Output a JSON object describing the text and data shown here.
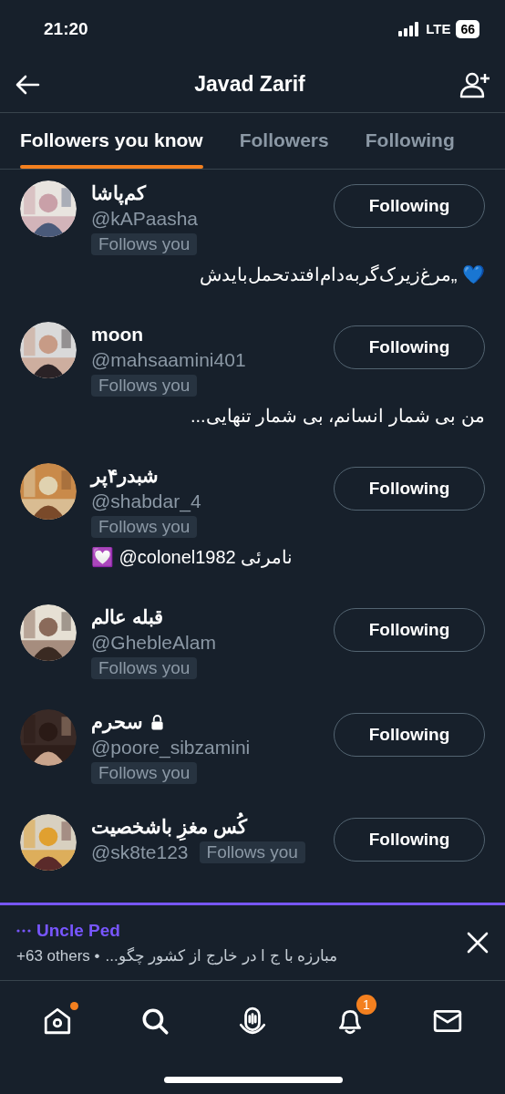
{
  "status_bar": {
    "time": "21:20",
    "network": "LTE",
    "battery": "66"
  },
  "header": {
    "title": "Javad Zarif"
  },
  "tabs": [
    {
      "label": "Followers you know",
      "selected": true
    },
    {
      "label": "Followers",
      "selected": false
    },
    {
      "label": "Following",
      "selected": false
    }
  ],
  "users": [
    {
      "name": "کم‌پاشا",
      "handle": "@kAPaasha",
      "follows_you": "Follows you",
      "protected": false,
      "kind": "stacked",
      "button": "Following",
      "bio": "💙 „مرغ‌زیرک‌گربه‌دام‌افتدتحمل‌بایدش"
    },
    {
      "name": "moon",
      "handle": "@mahsaamini401",
      "follows_you": "Follows you",
      "protected": false,
      "kind": "stacked",
      "button": "Following",
      "bio": "من بی شمار انسانم، بی شمار تنهایی..."
    },
    {
      "name": "شبدر۴پر",
      "handle": "@shabdar_4",
      "follows_you": "Follows you",
      "protected": false,
      "kind": "stacked",
      "button": "Following",
      "bio": "💟 @colonel1982 نامرئی"
    },
    {
      "name": "قبله عالم",
      "handle": "@GhebleAlam",
      "follows_you": "Follows you",
      "protected": false,
      "kind": "stacked",
      "button": "Following"
    },
    {
      "name": "سحرم",
      "handle": "@poore_sibzamini",
      "follows_you": "Follows you",
      "protected": true,
      "kind": "stacked",
      "button": "Following"
    },
    {
      "name": "کُس مغزِ باشخصیت",
      "handle": "@sk8te123",
      "follows_you": "Follows you",
      "protected": false,
      "kind": "inline",
      "button": "Following"
    }
  ],
  "space_banner": {
    "host": "Uncle Ped",
    "others": "+63 others •",
    "title": "مبارزه با ج ا در خارج از کشور چگو..."
  },
  "nav": [
    {
      "kind": "home",
      "dot": true
    },
    {
      "kind": "search",
      "dot": false
    },
    {
      "kind": "spaces",
      "dot": false
    },
    {
      "kind": "notifications",
      "dot": false,
      "badge": "1"
    },
    {
      "kind": "messages",
      "dot": false
    }
  ]
}
